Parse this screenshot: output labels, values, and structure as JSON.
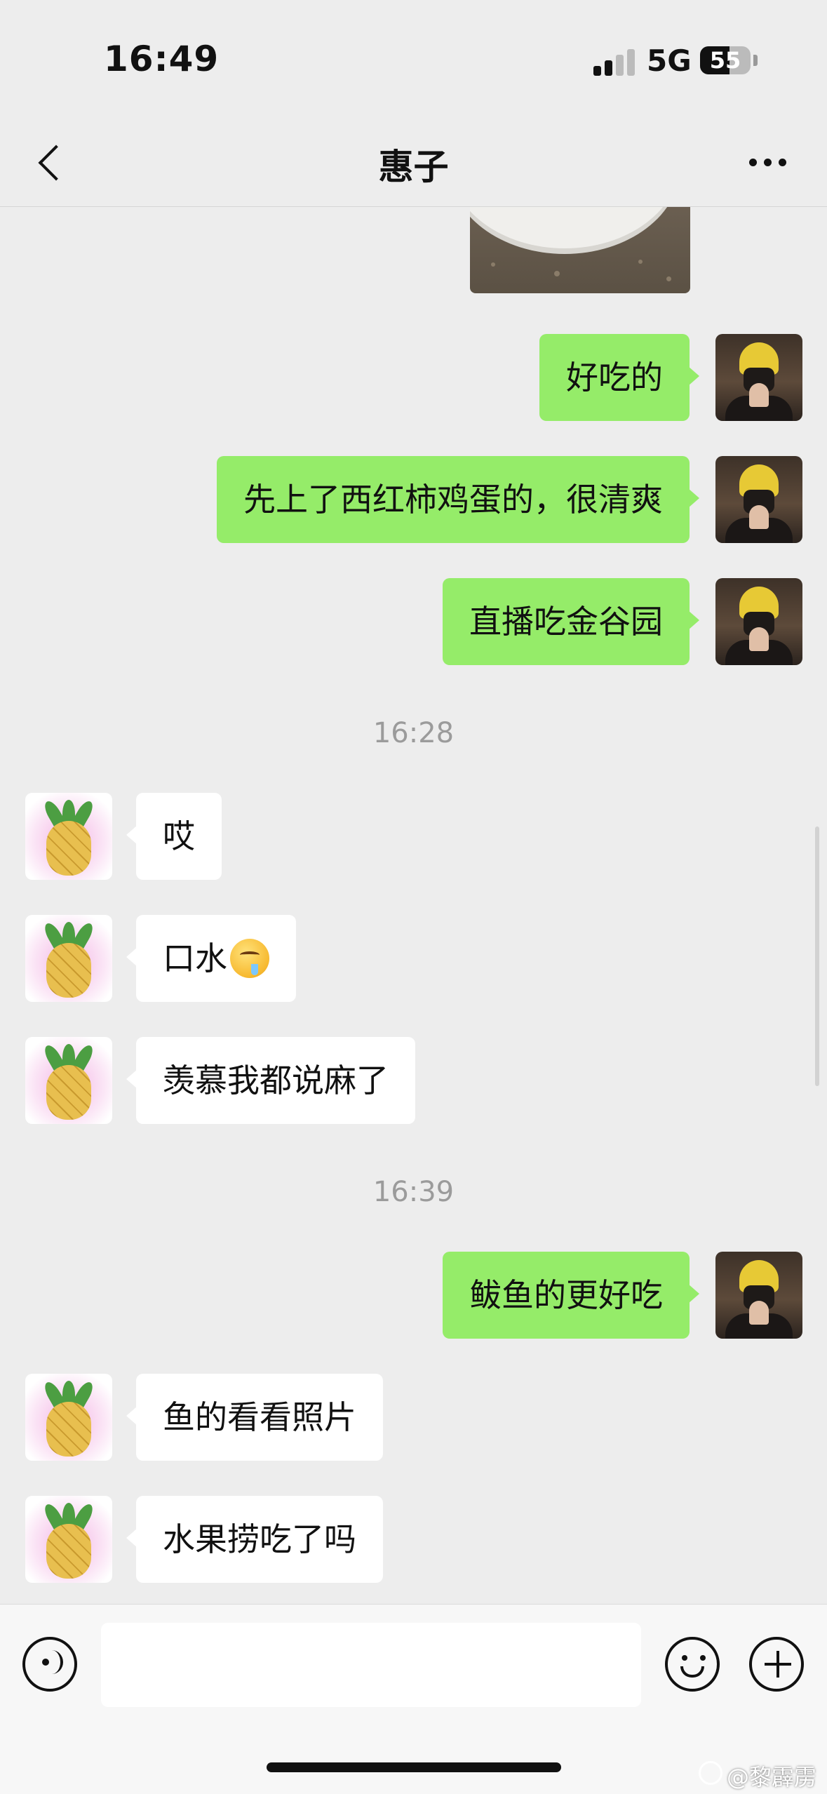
{
  "status_bar": {
    "time": "16:49",
    "network": "5G",
    "battery": "55"
  },
  "nav": {
    "title": "惠子"
  },
  "chat": {
    "messages": [
      {
        "type": "image",
        "sender": "me",
        "description": "food photo"
      },
      {
        "type": "text",
        "sender": "me",
        "text": "好吃的"
      },
      {
        "type": "text",
        "sender": "me",
        "text": "先上了西红柿鸡蛋的，很清爽"
      },
      {
        "type": "text",
        "sender": "me",
        "text": "直播吃金谷园"
      },
      {
        "type": "time",
        "text": "16:28"
      },
      {
        "type": "text",
        "sender": "other",
        "text": "哎"
      },
      {
        "type": "text",
        "sender": "other",
        "text": "口水",
        "emoji": "drooling-face"
      },
      {
        "type": "text",
        "sender": "other",
        "text": "羡慕我都说麻了"
      },
      {
        "type": "time",
        "text": "16:39"
      },
      {
        "type": "text",
        "sender": "me",
        "text": "鲅鱼的更好吃"
      },
      {
        "type": "text",
        "sender": "other",
        "text": "鱼的看看照片"
      },
      {
        "type": "text",
        "sender": "other",
        "text": "水果捞吃了吗"
      }
    ]
  },
  "input_bar": {
    "message_value": "",
    "icons": [
      "voice-icon",
      "emoji-icon",
      "plus-icon"
    ]
  },
  "watermark": {
    "text": "@黎霹雳"
  },
  "colors": {
    "background": "#ededed",
    "bubble_me": "#95ec69",
    "bubble_other": "#ffffff",
    "timestamp": "#9b9b9b"
  }
}
